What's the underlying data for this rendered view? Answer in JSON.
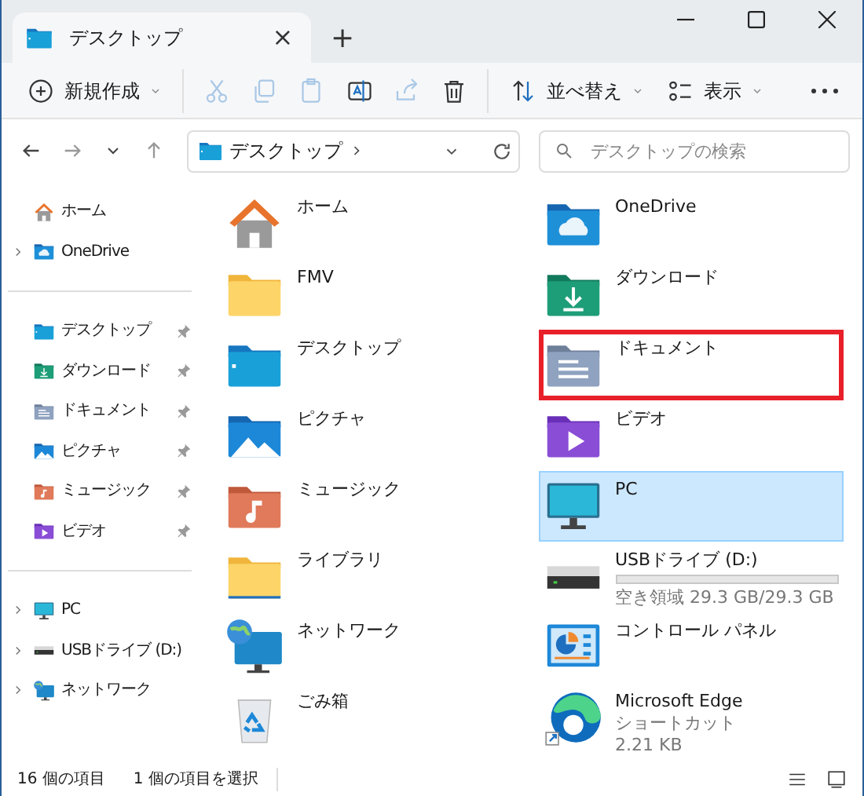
{
  "tab": {
    "title": "デスクトップ",
    "close": "×",
    "new_tab": "+"
  },
  "toolbar": [
    {
      "kind": "new",
      "label": "新規作成",
      "disabled": false
    },
    {
      "kind": "cut",
      "disabled": true
    },
    {
      "kind": "copy",
      "disabled": true
    },
    {
      "kind": "paste",
      "disabled": true
    },
    {
      "kind": "rename",
      "disabled": false
    },
    {
      "kind": "share",
      "disabled": true
    },
    {
      "kind": "delete",
      "disabled": false
    },
    {
      "kind": "sort",
      "label": "並べ替え",
      "disabled": false
    },
    {
      "kind": "view",
      "label": "表示",
      "disabled": false
    },
    {
      "kind": "more",
      "disabled": false
    }
  ],
  "address": {
    "path": "デスクトップ",
    "search_placeholder": "デスクトップの検索"
  },
  "sidebar": [
    [
      {
        "kind": "home",
        "label": "ホーム",
        "expandable": false,
        "pinned": false
      },
      {
        "kind": "onedrive",
        "label": "OneDrive",
        "expandable": true,
        "pinned": false
      }
    ],
    [
      {
        "kind": "desktop",
        "label": "デスクトップ",
        "expandable": false,
        "pinned": true
      },
      {
        "kind": "download",
        "label": "ダウンロード",
        "expandable": false,
        "pinned": true
      },
      {
        "kind": "documents",
        "label": "ドキュメント",
        "expandable": false,
        "pinned": true
      },
      {
        "kind": "pictures",
        "label": "ピクチャ",
        "expandable": false,
        "pinned": true
      },
      {
        "kind": "music",
        "label": "ミュージック",
        "expandable": false,
        "pinned": true
      },
      {
        "kind": "videos",
        "label": "ビデオ",
        "expandable": false,
        "pinned": true
      }
    ],
    [
      {
        "kind": "pc",
        "label": "PC",
        "expandable": true,
        "pinned": false
      },
      {
        "kind": "drive",
        "label": "USBドライブ (D:)",
        "expandable": true,
        "pinned": false
      },
      {
        "kind": "network",
        "label": "ネットワーク",
        "expandable": true,
        "pinned": false
      }
    ]
  ],
  "items": [
    {
      "kind": "home",
      "name": "ホーム",
      "selected": false,
      "highlighted": false
    },
    {
      "kind": "onedrive",
      "name": "OneDrive",
      "selected": false,
      "highlighted": false
    },
    {
      "kind": "folder",
      "name": "FMV",
      "selected": false,
      "highlighted": false
    },
    {
      "kind": "download",
      "name": "ダウンロード",
      "selected": false,
      "highlighted": false
    },
    {
      "kind": "desktop",
      "name": "デスクトップ",
      "selected": false,
      "highlighted": false
    },
    {
      "kind": "documents",
      "name": "ドキュメント",
      "selected": false,
      "highlighted": true
    },
    {
      "kind": "pictures",
      "name": "ピクチャ",
      "selected": false,
      "highlighted": false
    },
    {
      "kind": "videos",
      "name": "ビデオ",
      "selected": false,
      "highlighted": false
    },
    {
      "kind": "music",
      "name": "ミュージック",
      "selected": false,
      "highlighted": false
    },
    {
      "kind": "pc",
      "name": "PC",
      "selected": true,
      "highlighted": false
    },
    {
      "kind": "library",
      "name": "ライブラリ",
      "selected": false,
      "highlighted": false
    },
    {
      "kind": "drive",
      "name": "USBドライブ (D:)",
      "selected": false,
      "highlighted": false,
      "level": 0,
      "details": [
        "空き領域 29.3 GB/29.3 GB"
      ]
    },
    {
      "kind": "network",
      "name": "ネットワーク",
      "selected": false,
      "highlighted": false
    },
    {
      "kind": "control",
      "name": "コントロール パネル",
      "selected": false,
      "highlighted": false
    },
    {
      "kind": "trash",
      "name": "ごみ箱",
      "selected": false,
      "highlighted": false
    },
    {
      "kind": "edge",
      "name": "Microsoft Edge",
      "selected": false,
      "highlighted": false,
      "details": [
        "ショートカット",
        "2.21 KB"
      ]
    }
  ],
  "status_bar": {
    "count": "16 個の項目",
    "selection": "1 個の項目を選択"
  }
}
